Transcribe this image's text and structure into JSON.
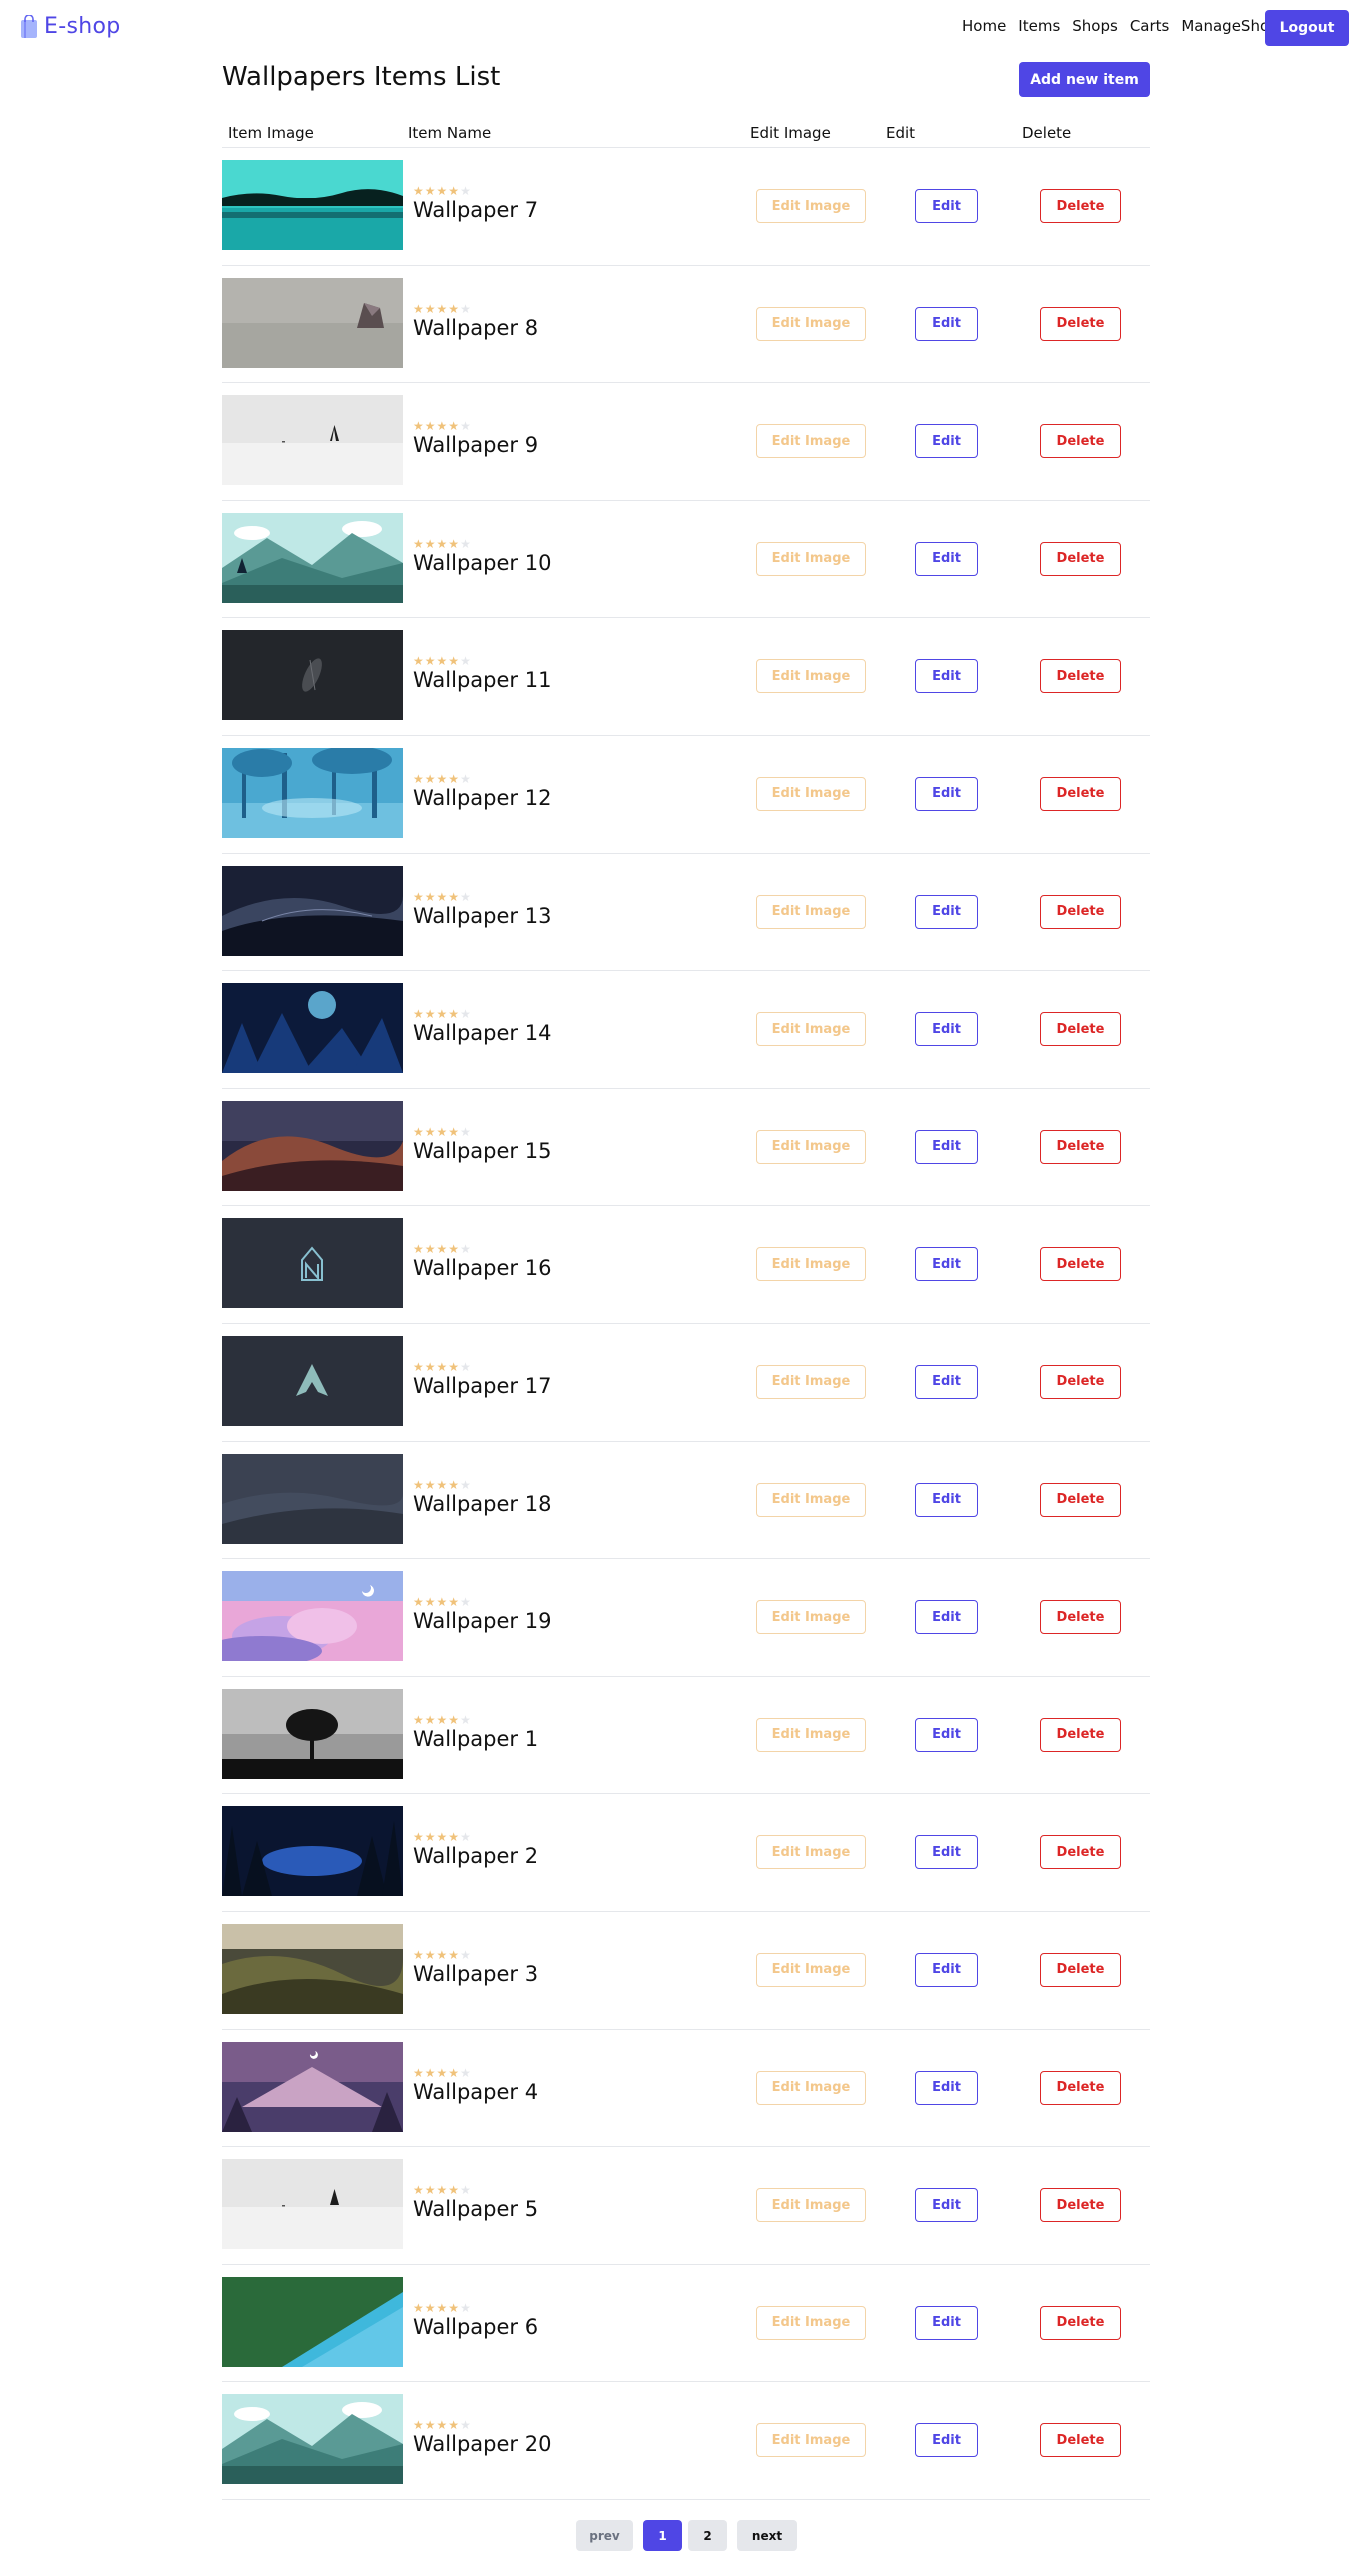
{
  "nav": {
    "brand": "E-shop",
    "links": [
      "Home",
      "Items",
      "Shops",
      "Carts",
      "ManageShops"
    ],
    "logout_label": "Logout"
  },
  "page": {
    "title": "Wallpapers Items List",
    "add_label": "Add new item"
  },
  "table": {
    "headers": [
      "Item Image",
      "Item Name",
      "Edit Image",
      "Edit",
      "Delete"
    ],
    "edit_image_label": "Edit Image",
    "edit_label": "Edit",
    "delete_label": "Delete",
    "rating": {
      "value": 4,
      "max": 5
    },
    "rows": [
      {
        "name": "Wallpaper 7"
      },
      {
        "name": "Wallpaper 8"
      },
      {
        "name": "Wallpaper 9"
      },
      {
        "name": "Wallpaper 10"
      },
      {
        "name": "Wallpaper 11"
      },
      {
        "name": "Wallpaper 12"
      },
      {
        "name": "Wallpaper 13"
      },
      {
        "name": "Wallpaper 14"
      },
      {
        "name": "Wallpaper 15"
      },
      {
        "name": "Wallpaper 16"
      },
      {
        "name": "Wallpaper 17"
      },
      {
        "name": "Wallpaper 18"
      },
      {
        "name": "Wallpaper 19"
      },
      {
        "name": "Wallpaper 1"
      },
      {
        "name": "Wallpaper 2"
      },
      {
        "name": "Wallpaper 3"
      },
      {
        "name": "Wallpaper 4"
      },
      {
        "name": "Wallpaper 5"
      },
      {
        "name": "Wallpaper 6"
      },
      {
        "name": "Wallpaper 20"
      }
    ]
  },
  "pagination": {
    "prev_label": "prev",
    "pages": [
      "1",
      "2"
    ],
    "current": "1",
    "next_label": "next"
  },
  "colors": {
    "accent": "#4f46e5",
    "danger": "#dc2626",
    "warning": "#f3c78b",
    "star": "#f0c27a"
  }
}
